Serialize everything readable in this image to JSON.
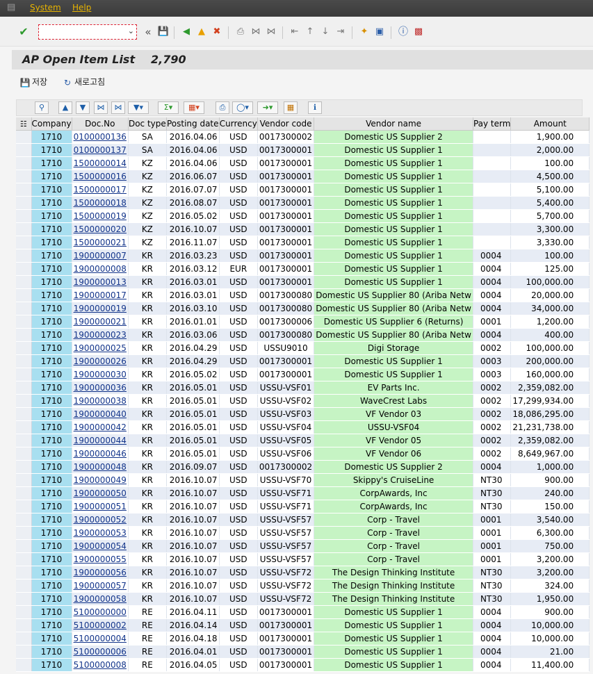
{
  "menu": {
    "items": [
      "System",
      "Help"
    ]
  },
  "toolbar": {
    "command_value": ""
  },
  "title": {
    "text": "AP Open Item List",
    "count": "2,790"
  },
  "app_toolbar": {
    "save_label": "저장",
    "refresh_label": "새로고침"
  },
  "table": {
    "columns": [
      "Company",
      "Doc.No",
      "Doc type",
      "Posting date",
      "Currency",
      "Vendor code",
      "Vendor name",
      "Pay term",
      "Amount"
    ],
    "rows": [
      [
        "1710",
        "0100000136",
        "SA",
        "2016.04.06",
        "USD",
        "0017300002",
        "Domestic US Supplier 2",
        "",
        "1,900.00"
      ],
      [
        "1710",
        "0100000137",
        "SA",
        "2016.04.06",
        "USD",
        "0017300001",
        "Domestic US Supplier 1",
        "",
        "2,000.00"
      ],
      [
        "1710",
        "1500000014",
        "KZ",
        "2016.04.06",
        "USD",
        "0017300001",
        "Domestic US Supplier 1",
        "",
        "100.00"
      ],
      [
        "1710",
        "1500000016",
        "KZ",
        "2016.06.07",
        "USD",
        "0017300001",
        "Domestic US Supplier 1",
        "",
        "4,500.00"
      ],
      [
        "1710",
        "1500000017",
        "KZ",
        "2016.07.07",
        "USD",
        "0017300001",
        "Domestic US Supplier 1",
        "",
        "5,100.00"
      ],
      [
        "1710",
        "1500000018",
        "KZ",
        "2016.08.07",
        "USD",
        "0017300001",
        "Domestic US Supplier 1",
        "",
        "5,400.00"
      ],
      [
        "1710",
        "1500000019",
        "KZ",
        "2016.05.02",
        "USD",
        "0017300001",
        "Domestic US Supplier 1",
        "",
        "5,700.00"
      ],
      [
        "1710",
        "1500000020",
        "KZ",
        "2016.10.07",
        "USD",
        "0017300001",
        "Domestic US Supplier 1",
        "",
        "3,300.00"
      ],
      [
        "1710",
        "1500000021",
        "KZ",
        "2016.11.07",
        "USD",
        "0017300001",
        "Domestic US Supplier 1",
        "",
        "3,330.00"
      ],
      [
        "1710",
        "1900000007",
        "KR",
        "2016.03.23",
        "USD",
        "0017300001",
        "Domestic US Supplier 1",
        "0004",
        "100.00"
      ],
      [
        "1710",
        "1900000008",
        "KR",
        "2016.03.12",
        "EUR",
        "0017300001",
        "Domestic US Supplier 1",
        "0004",
        "125.00"
      ],
      [
        "1710",
        "1900000013",
        "KR",
        "2016.03.01",
        "USD",
        "0017300001",
        "Domestic US Supplier 1",
        "0004",
        "100,000.00"
      ],
      [
        "1710",
        "1900000017",
        "KR",
        "2016.03.01",
        "USD",
        "0017300080",
        "Domestic US Supplier 80 (Ariba Netw",
        "0004",
        "20,000.00"
      ],
      [
        "1710",
        "1900000019",
        "KR",
        "2016.03.10",
        "USD",
        "0017300080",
        "Domestic US Supplier 80 (Ariba Netw",
        "0004",
        "34,000.00"
      ],
      [
        "1710",
        "1900000021",
        "KR",
        "2016.01.01",
        "USD",
        "0017300006",
        "Domestic US Supplier 6 (Returns)",
        "0001",
        "1,200.00"
      ],
      [
        "1710",
        "1900000023",
        "KR",
        "2016.03.06",
        "USD",
        "0017300080",
        "Domestic US Supplier 80 (Ariba Netw",
        "0004",
        "400.00"
      ],
      [
        "1710",
        "1900000025",
        "KR",
        "2016.04.29",
        "USD",
        "USSU9010",
        "Digi Storage",
        "0002",
        "100,000.00"
      ],
      [
        "1710",
        "1900000026",
        "KR",
        "2016.04.29",
        "USD",
        "0017300001",
        "Domestic US Supplier 1",
        "0003",
        "200,000.00"
      ],
      [
        "1710",
        "1900000030",
        "KR",
        "2016.05.02",
        "USD",
        "0017300001",
        "Domestic US Supplier 1",
        "0003",
        "160,000.00"
      ],
      [
        "1710",
        "1900000036",
        "KR",
        "2016.05.01",
        "USD",
        "USSU-VSF01",
        "EV Parts Inc.",
        "0002",
        "2,359,082.00"
      ],
      [
        "1710",
        "1900000038",
        "KR",
        "2016.05.01",
        "USD",
        "USSU-VSF02",
        "WaveCrest Labs",
        "0002",
        "17,299,934.00"
      ],
      [
        "1710",
        "1900000040",
        "KR",
        "2016.05.01",
        "USD",
        "USSU-VSF03",
        "VF Vendor 03",
        "0002",
        "18,086,295.00"
      ],
      [
        "1710",
        "1900000042",
        "KR",
        "2016.05.01",
        "USD",
        "USSU-VSF04",
        "USSU-VSF04",
        "0002",
        "21,231,738.00"
      ],
      [
        "1710",
        "1900000044",
        "KR",
        "2016.05.01",
        "USD",
        "USSU-VSF05",
        "VF Vendor 05",
        "0002",
        "2,359,082.00"
      ],
      [
        "1710",
        "1900000046",
        "KR",
        "2016.05.01",
        "USD",
        "USSU-VSF06",
        "VF Vendor 06",
        "0002",
        "8,649,967.00"
      ],
      [
        "1710",
        "1900000048",
        "KR",
        "2016.09.07",
        "USD",
        "0017300002",
        "Domestic US Supplier 2",
        "0004",
        "1,000.00"
      ],
      [
        "1710",
        "1900000049",
        "KR",
        "2016.10.07",
        "USD",
        "USSU-VSF70",
        "Skippy's CruiseLine",
        "NT30",
        "900.00"
      ],
      [
        "1710",
        "1900000050",
        "KR",
        "2016.10.07",
        "USD",
        "USSU-VSF71",
        "CorpAwards, Inc",
        "NT30",
        "240.00"
      ],
      [
        "1710",
        "1900000051",
        "KR",
        "2016.10.07",
        "USD",
        "USSU-VSF71",
        "CorpAwards, Inc",
        "NT30",
        "150.00"
      ],
      [
        "1710",
        "1900000052",
        "KR",
        "2016.10.07",
        "USD",
        "USSU-VSF57",
        "Corp - Travel",
        "0001",
        "3,540.00"
      ],
      [
        "1710",
        "1900000053",
        "KR",
        "2016.10.07",
        "USD",
        "USSU-VSF57",
        "Corp - Travel",
        "0001",
        "6,300.00"
      ],
      [
        "1710",
        "1900000054",
        "KR",
        "2016.10.07",
        "USD",
        "USSU-VSF57",
        "Corp - Travel",
        "0001",
        "750.00"
      ],
      [
        "1710",
        "1900000055",
        "KR",
        "2016.10.07",
        "USD",
        "USSU-VSF57",
        "Corp - Travel",
        "0001",
        "3,200.00"
      ],
      [
        "1710",
        "1900000056",
        "KR",
        "2016.10.07",
        "USD",
        "USSU-VSF72",
        "The Design Thinking Institute",
        "NT30",
        "3,200.00"
      ],
      [
        "1710",
        "1900000057",
        "KR",
        "2016.10.07",
        "USD",
        "USSU-VSF72",
        "The Design Thinking Institute",
        "NT30",
        "324.00"
      ],
      [
        "1710",
        "1900000058",
        "KR",
        "2016.10.07",
        "USD",
        "USSU-VSF72",
        "The Design Thinking Institute",
        "NT30",
        "1,950.00"
      ],
      [
        "1710",
        "5100000000",
        "RE",
        "2016.04.11",
        "USD",
        "0017300001",
        "Domestic US Supplier 1",
        "0004",
        "900.00"
      ],
      [
        "1710",
        "5100000002",
        "RE",
        "2016.04.14",
        "USD",
        "0017300001",
        "Domestic US Supplier 1",
        "0004",
        "10,000.00"
      ],
      [
        "1710",
        "5100000004",
        "RE",
        "2016.04.18",
        "USD",
        "0017300001",
        "Domestic US Supplier 1",
        "0004",
        "10,000.00"
      ],
      [
        "1710",
        "5100000006",
        "RE",
        "2016.04.01",
        "USD",
        "0017300001",
        "Domestic US Supplier 1",
        "0004",
        "21.00"
      ],
      [
        "1710",
        "5100000008",
        "RE",
        "2016.04.05",
        "USD",
        "0017300001",
        "Domestic US Supplier 1",
        "0004",
        "11,400.00"
      ]
    ]
  },
  "colors": {
    "key_column": "#a8dff0",
    "vendor_column": "#c6f4c4",
    "stripe": "#e7ecf5",
    "menu_text": "#e8b400"
  }
}
